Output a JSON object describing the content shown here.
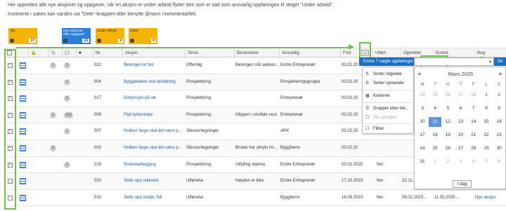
{
  "intro": {
    "line1": "Her opprettes alle nye aksjoner og oppgaver, når en aksjon er under arbeid flytter den som er satt som ansvarlig oppføringen til steget \"Under arbeid\".",
    "line2": "Involverte i saken kan varsles via \"Dele\"-knappen eller benytte @navn i kommentarfelt."
  },
  "tiles": [
    {
      "label": "Alle",
      "count": "17",
      "color": "#f5b400"
    },
    {
      "label": "Nye aksjoner eller oppgaver",
      "count": "13",
      "color": "#2a7fd8"
    },
    {
      "label": "Under arbeid",
      "count": "2",
      "color": "#f5b400"
    },
    {
      "label": "Utført",
      "count": "0",
      "color": "#f5b400"
    }
  ],
  "columns": {
    "nr": "Nr.",
    "aksjon": "Aksjon",
    "tema": "Tema",
    "beskrivelse": "Beskrivelse",
    "ansvarlig": "Ansvarlig",
    "frist": "Frist",
    "utfort": "Utført",
    "opprettet": "Opprettet",
    "endret": "Endret",
    "steg": "Steg"
  },
  "rows": [
    {
      "checked": true,
      "attach": "1",
      "comments": "1",
      "nr": "022",
      "aksjon": "Betongen er feil",
      "tema": "Offentlig",
      "beskrivelse": "Betongen må sjekkes...",
      "ansvarlig": "Endre Entreprenør",
      "frist": "03.02.20",
      "utfort": "",
      "opprettet": "",
      "endret": "",
      "steg": ""
    },
    {
      "checked": true,
      "attach": "",
      "comments": "1",
      "nr": "004",
      "aksjon": "Byggeledere ved røreldning",
      "tema": "Prosjektering",
      "beskrivelse": "",
      "ansvarlig": "Prosjekteringsgruppe",
      "frist": "03.02.20",
      "utfort": "",
      "opprettet": "",
      "endret": "",
      "steg": ""
    },
    {
      "checked": true,
      "attach": "",
      "comments": "2",
      "nr": "017",
      "aksjon": "Dimensjon på rør",
      "tema": "Prosjektering",
      "beskrivelse": "",
      "ansvarlig": "Entreprenør",
      "frist": "03.02.20",
      "utfort": "",
      "opprettet": "",
      "endret": "",
      "steg": ""
    },
    {
      "checked": true,
      "attach": "1",
      "comments": "2(1)",
      "nr": "009",
      "aksjon": "Flytt lyktestolpe",
      "tema": "Prosjektering",
      "beskrivelse": "Glippen i område vest...",
      "ansvarlig": "Entreprenør",
      "frist": "03.02.20",
      "utfort": "",
      "opprettet": "",
      "endret": "",
      "steg": ""
    },
    {
      "checked": true,
      "attach": "",
      "comments": "1",
      "nr": "007",
      "aksjon": "Hvilken farge skal det være p...",
      "tema": "Skisser/tegninger",
      "beskrivelse": "",
      "ansvarlig": "ARK",
      "frist": "03.02.20",
      "utfort": "",
      "opprettet": "",
      "endret": "",
      "steg": ""
    },
    {
      "checked": true,
      "attach": "3",
      "comments": "",
      "nr": "003",
      "aksjon": "Hvilken farge skal det være p...",
      "tema": "Skisser/tegninger",
      "beskrivelse": "Bruker har uttrykt mi...",
      "ansvarlig": "Byggherre",
      "frist": "03.02.20",
      "utfort": "",
      "opprettet": "",
      "endret": "",
      "steg": ""
    },
    {
      "checked": true,
      "attach": "",
      "comments": "2",
      "nr": "019",
      "aksjon": "Risikokartlegging",
      "tema": "Prosjektering",
      "beskrivelse": "Utfylling skjema",
      "ansvarlig": "Endre Entreprenør",
      "frist": "03.02.2025",
      "utfort": "Nei",
      "opprettet": "",
      "endret": "",
      "steg": ""
    },
    {
      "checked": false,
      "attach": "",
      "comments": "",
      "nr": "020",
      "aksjon": "Sette opp rekkverk",
      "tema": "Utførelse",
      "beskrivelse": "Høyden er ikke",
      "ansvarlig": "Endre Entreprenør",
      "frist": "17.10.2023",
      "utfort": "Nei",
      "opprettet": "22.11.2022 ...",
      "endret": "11.03.2025 ...",
      "steg": "Nye aksjon"
    },
    {
      "checked": false,
      "attach": "",
      "comments": "",
      "nr": "010",
      "aksjon": "Sette opp stolpe, feil",
      "tema": "Utførelse",
      "beskrivelse": "",
      "ansvarlig": "Byggherre",
      "frist": "18.09.2023",
      "utfort": "Nei",
      "opprettet": "09.02.2023 ...",
      "endret": "11.03.2025 ...",
      "steg": "Nye aksjon"
    }
  ],
  "filterbar": {
    "label": "Endre 7 valgte oppføringer"
  },
  "menu": {
    "items": [
      "Sorter stigende",
      "Sorter synkende",
      "Kolonner",
      "Grupper etter det...",
      "Vis i grupper",
      "Filtrer"
    ]
  },
  "calendar": {
    "title": "Mars 2025",
    "prev": "◀",
    "next": "▶",
    "ok": "Ok",
    "idag": "I dag",
    "dow": [
      "M",
      "T",
      "O",
      "T",
      "F",
      "L",
      "S"
    ],
    "weeks": [
      [
        "24",
        "25",
        "26",
        "27",
        "28",
        "1",
        "2"
      ],
      [
        "3",
        "4",
        "5",
        "6",
        "7",
        "8",
        "9"
      ],
      [
        "10",
        "11",
        "12",
        "13",
        "14",
        "15",
        "16"
      ],
      [
        "17",
        "18",
        "19",
        "20",
        "21",
        "22",
        "23"
      ],
      [
        "24",
        "25",
        "26",
        "27",
        "28",
        "29",
        "30"
      ],
      [
        "31",
        "1",
        "2",
        "3",
        "4",
        "5",
        "6"
      ]
    ],
    "selected": "11"
  }
}
